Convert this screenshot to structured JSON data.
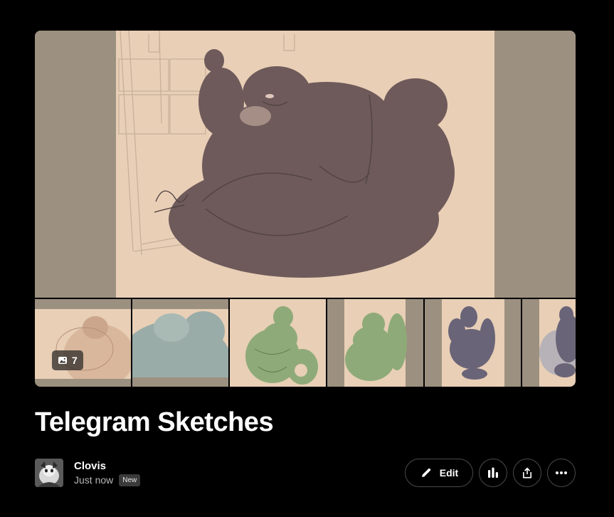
{
  "gallery": {
    "image_count": "7",
    "count_icon": "image-icon"
  },
  "post": {
    "title": "Telegram Sketches"
  },
  "author": {
    "name": "Clovis",
    "timestamp": "Just now",
    "badge": "New"
  },
  "actions": {
    "edit_label": "Edit",
    "edit_icon": "pencil-icon",
    "stats_icon": "bar-chart-icon",
    "share_icon": "share-icon",
    "more_icon": "more-icon"
  },
  "colors": {
    "background": "#000000",
    "paper": "#e8cfb6",
    "sketch_brown": "#6e5a5a",
    "sketch_blue": "#9aaca8",
    "sketch_green": "#8eaa78",
    "sketch_purple": "#6a6478",
    "border": "#4a4a4a"
  }
}
